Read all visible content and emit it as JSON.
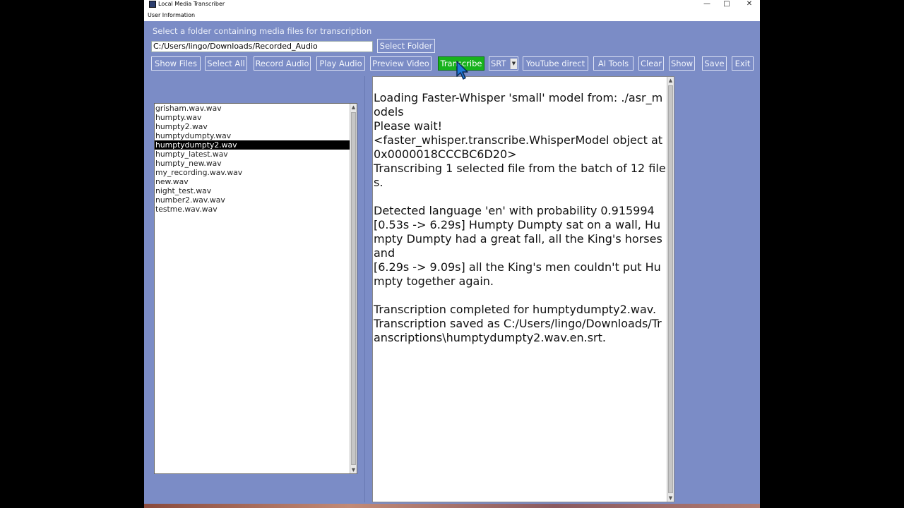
{
  "window": {
    "title": "Local Media Transcriber",
    "minimize": "—",
    "maximize": "□",
    "close": "✕"
  },
  "menu": {
    "user_info": "User Information"
  },
  "instruction": "Select a folder containing media files for transcription",
  "folder": {
    "path": "C:/Users/lingo/Downloads/Recorded_Audio",
    "select_label": "Select Folder"
  },
  "toolbar": {
    "show_files": "Show Files",
    "select_all": "Select All",
    "record_audio": "Record Audio",
    "play_audio": "Play Audio",
    "preview_video": "Preview Video",
    "transcribe": "Transcribe",
    "format_selected": "SRT",
    "youtube_direct": "YouTube direct",
    "ai_tools": "AI Tools",
    "clear": "Clear",
    "show": "Show",
    "save": "Save",
    "exit": "Exit"
  },
  "files": [
    "grisham.wav.wav",
    "humpty.wav",
    "humpty2.wav",
    "humptydumpty.wav",
    "humptydumpty2.wav",
    "humpty_latest.wav",
    "humpty_new.wav",
    "my_recording.wav.wav",
    "new.wav",
    "night_test.wav",
    "number2.wav.wav",
    "testme.wav.wav"
  ],
  "selected_file": "humptydumpty2.wav",
  "output": {
    "lines": [
      "Loading Faster-Whisper 'small' model from: ./asr_models",
      "Please wait!",
      "<faster_whisper.transcribe.WhisperModel object at 0x0000018CCCBC6D20>",
      "Transcribing 1 selected file from the batch of 12 files.",
      "",
      "Detected language 'en' with probability 0.915994",
      "[0.53s -> 6.29s] Humpty Dumpty sat on a wall, Humpty Dumpty had a great fall, all the King's horses and",
      "[6.29s -> 9.09s] all the King's men couldn't put Humpty together again.",
      "",
      "Transcription completed for humptydumpty2.wav.",
      "Transcription saved as C:/Users/lingo/Downloads/Transcriptions\\humptydumpty2.wav.en.srt."
    ]
  },
  "icons": {
    "scroll_up": "up-arrow-icon",
    "scroll_down": "down-arrow-icon",
    "dropdown": "chevron-down-icon",
    "mouse_cursor": "mouse-pointer-icon"
  },
  "colors": {
    "window_bg": "#7b8cc6",
    "transcribe_active": "#17b21c",
    "selection": "#000000"
  }
}
